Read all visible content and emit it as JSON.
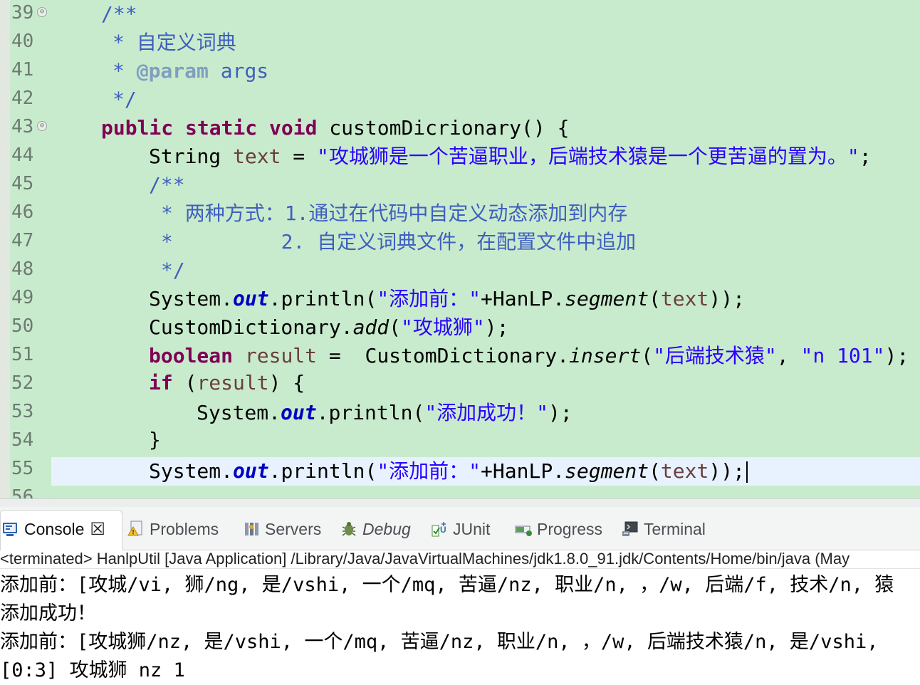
{
  "editor": {
    "line_numbers": [
      "39",
      "40",
      "41",
      "42",
      "43",
      "44",
      "45",
      "46",
      "47",
      "48",
      "49",
      "50",
      "51",
      "52",
      "53",
      "54",
      "55",
      "56"
    ],
    "fold_markers": [
      "⊖",
      "⊖"
    ],
    "lines": [
      {
        "c": "/**"
      },
      {
        "c": "* 自定义词典"
      },
      {
        "c1": "* ",
        "tag": "@param",
        "c2": " args"
      },
      {
        "c": "*/"
      },
      {
        "kw": "public static void",
        "rest": " customDicrionary() {"
      },
      {
        "type": "String ",
        "var": "text",
        "eq": " = ",
        "str": "\"攻城狮是一个苦逼职业，后端技术猿是一个更苦逼的置为。\"",
        "end": ";"
      },
      {
        "c": "/**"
      },
      {
        "c": "* 两种方式：1.通过在代码中自定义动态添加到内存"
      },
      {
        "c": "*         2. 自定义词典文件，在配置文件中追加"
      },
      {
        "c": "*/"
      },
      {
        "a": "System.",
        "fld": "out",
        "b": ".println(",
        "str": "\"添加前：\"",
        "c": "+HanLP.",
        "m": "segment",
        "d": "(",
        "var": "text",
        "e": "));"
      },
      {
        "a": "CustomDictionary.",
        "m": "add",
        "b": "(",
        "str": "\"攻城狮\"",
        "e": ");"
      },
      {
        "kw": "boolean",
        "sp": " ",
        "var": "result",
        "eq": " =  CustomDictionary.",
        "m": "insert",
        "b": "(",
        "str1": "\"后端技术猿\"",
        "comma": ", ",
        "str2": "\"n 101\"",
        "e": ");"
      },
      {
        "kw": "if",
        "b": " (",
        "var": "result",
        "e": ") {"
      },
      {
        "a": "System.",
        "fld": "out",
        "b": ".println(",
        "str": "\"添加成功！\"",
        "e": ");"
      },
      {
        "c": "}"
      },
      {
        "a": "System.",
        "fld": "out",
        "b": ".println(",
        "str": "\"添加前：\"",
        "c": "+HanLP.",
        "m": "segment",
        "d": "(",
        "var": "text",
        "e": "));"
      }
    ]
  },
  "panel": {
    "tabs": [
      {
        "label": "Console",
        "icon": "console-icon"
      },
      {
        "label": "Problems",
        "icon": "problems-icon"
      },
      {
        "label": "Servers",
        "icon": "servers-icon"
      },
      {
        "label": "Debug",
        "icon": "debug-icon"
      },
      {
        "label": "JUnit",
        "icon": "junit-icon"
      },
      {
        "label": "Progress",
        "icon": "progress-icon"
      },
      {
        "label": "Terminal",
        "icon": "terminal-icon"
      }
    ],
    "close_glyph": "☒",
    "status": "<terminated> HanlpUtil [Java Application] /Library/Java/JavaVirtualMachines/jdk1.8.0_91.jdk/Contents/Home/bin/java (May",
    "output": [
      "添加前：[攻城/vi, 狮/ng, 是/vshi, 一个/mq, 苦逼/nz, 职业/n, ，/w, 后端/f, 技术/n, 猿",
      "添加成功！",
      "添加前：[攻城狮/nz, 是/vshi, 一个/mq, 苦逼/nz, 职业/n, ，/w, 后端技术猿/n, 是/vshi,",
      "[0:3] 攻城狮 nz 1"
    ]
  },
  "colors": {
    "editor_bg": "#c9ebcd",
    "comment": "#3f5fbf",
    "keyword": "#7f0055",
    "string": "#2a00ff",
    "field": "#0000c0",
    "current_line": "#e8f2fe"
  }
}
